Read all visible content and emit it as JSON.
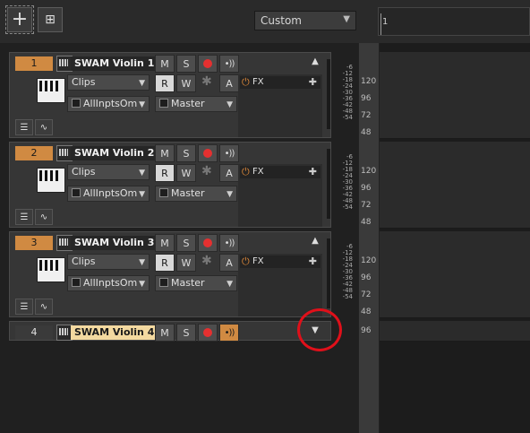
{
  "toolbar": {
    "add_label": "+",
    "duplicate_label": "⊞",
    "preset": "Custom",
    "ruler_mark": "1"
  },
  "tracks": [
    {
      "number": "1",
      "name": "SWAM Violin 1",
      "mute": "M",
      "solo": "S",
      "read": "R",
      "write": "W",
      "auto": "A",
      "input": "Clips",
      "io_in": "AllInptsOm",
      "io_out": "Master",
      "fx": "FX"
    },
    {
      "number": "2",
      "name": "SWAM Violin 2",
      "mute": "M",
      "solo": "S",
      "read": "R",
      "write": "W",
      "auto": "A",
      "input": "Clips",
      "io_in": "AllInptsOm",
      "io_out": "Master",
      "fx": "FX"
    },
    {
      "number": "3",
      "name": "SWAM Violin 3",
      "mute": "M",
      "solo": "S",
      "read": "R",
      "write": "W",
      "auto": "A",
      "input": "Clips",
      "io_in": "AllInptsOm",
      "io_out": "Master",
      "fx": "FX"
    },
    {
      "number": "4",
      "name": "SWAM Violin 4",
      "mute": "M",
      "solo": "S"
    }
  ],
  "meter_labels": [
    "-6",
    "-12",
    "-18",
    "-24",
    "-30",
    "-36",
    "-42",
    "-48",
    "-54"
  ],
  "velocity_labels": [
    "120",
    "96",
    "72",
    "48"
  ],
  "velocity_label_collapsed": "96",
  "colors": {
    "accent": "#d08a42",
    "record": "#e53030",
    "annotation": "#e0101a"
  },
  "icons": {
    "collapse": "double-chevron-down-icon",
    "expand": "double-chevron-up-icon"
  }
}
